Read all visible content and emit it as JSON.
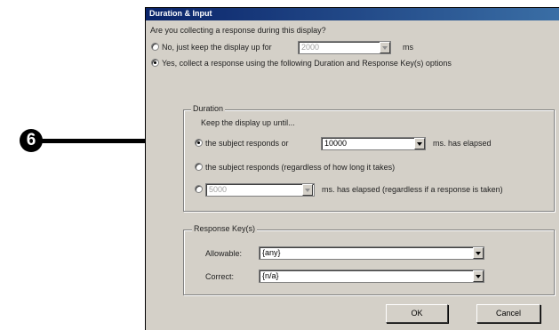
{
  "annotation": {
    "number": "6"
  },
  "dialog": {
    "title": "Duration & Input",
    "question": "Are you collecting a response during this display?",
    "option_no": {
      "label_prefix": "No, just keep the display up for",
      "value": "2000",
      "unit": "ms",
      "selected": false
    },
    "option_yes": {
      "label": "Yes, collect a response using the following Duration and Response Key(s) options",
      "selected": true
    },
    "duration": {
      "group_label": "Duration",
      "keep_label": "Keep the display up until...",
      "opt1": {
        "label": "the subject responds or",
        "value": "10000",
        "suffix": "ms. has elapsed",
        "selected": true
      },
      "opt2": {
        "label": "the subject responds (regardless of how long it takes)",
        "selected": false
      },
      "opt3": {
        "value": "5000",
        "suffix": "ms. has elapsed (regardless if a response is taken)",
        "selected": false
      }
    },
    "response_keys": {
      "group_label": "Response Key(s)",
      "allowable": {
        "label": "Allowable:",
        "value": "{any}"
      },
      "correct": {
        "label": "Correct:",
        "value": "{n/a}"
      }
    },
    "buttons": {
      "ok": "OK",
      "cancel": "Cancel"
    }
  }
}
